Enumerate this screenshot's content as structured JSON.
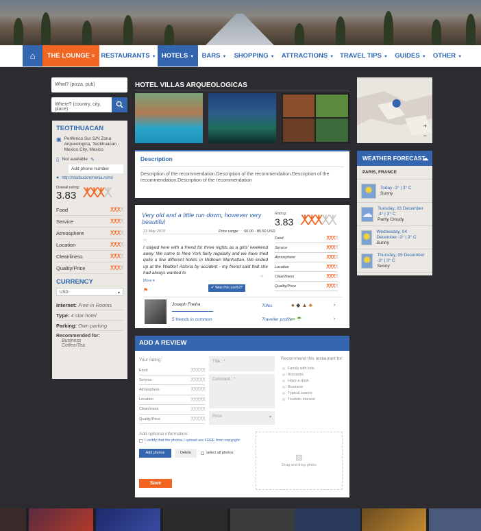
{
  "nav": {
    "lounge": "THE LOUNGE",
    "items": [
      "RESTAURANTS",
      "HOTELS",
      "BARS",
      "SHOPPING",
      "ATTRACTIONS",
      "TRAVEL TIPS",
      "GUIDES",
      "OTHER"
    ]
  },
  "search": {
    "what_placeholder": "What? (pizza, pub)",
    "where_placeholder": "Where? (country, city, place)"
  },
  "place": {
    "name": "TEOTIHUACAN",
    "address": "Periferico Sur S/N Zona Arqueologica, Teotihuacan - Mexico City, Mexico",
    "phone_status": "Not available",
    "phone_placeholder": "Add phone number",
    "website": "http://starbuckromania.ro/ro/",
    "overall_label": "Overall rating:",
    "overall_value": "3.83",
    "overall_fraction": 0.77,
    "ratings": [
      {
        "label": "Food",
        "value": 3
      },
      {
        "label": "Service",
        "value": 3
      },
      {
        "label": "Atmosphere",
        "value": 3
      },
      {
        "label": "Location",
        "value": 3
      },
      {
        "label": "Cleanliness",
        "value": 3
      },
      {
        "label": "Quality/Price",
        "value": 3
      }
    ],
    "currency_label": "CURRENCY",
    "currency_value": "USD",
    "internet_label": "Internet:",
    "internet_value": "Free in Rooms",
    "type_label": "Type:",
    "type_value": "4 star hotel",
    "parking_label": "Parking:",
    "parking_value": "Own parking",
    "recommended_label": "Recommended for:",
    "recommended": [
      "Business",
      "Coffee/Tea"
    ]
  },
  "hotel": {
    "title": "HOTEL VILLAS ARQUEOLOGICAS",
    "desc_title": "Description",
    "desc_text": "Description of the recommendation.Description of the recommendation.Description of the recommendation.Description of the recommendation"
  },
  "review": {
    "title": "Very old and a little run down, however very beautiful",
    "date": "23 May 2013",
    "price_label": "Price range:",
    "price_value": "60.00 - 85.50 USD",
    "text": "I stayed here with a friend for three nights as a girls' weekend away. We came to New York fairly regularly and we have tried quite a few different hotels in Midtown Manhattan. We ended up at the Waldorf Astoria by accident - my friend said that she had always wanted to",
    "more": "More",
    "useful": "Was this useful?",
    "rating_label": "Rating:",
    "rating_value": "3.83",
    "ratings": [
      "Food",
      "Service",
      "Atmosphere",
      "Location",
      "Cleanliness",
      "Quality/Price"
    ],
    "author": "Joseph Freiha",
    "friends": "5 friends in common",
    "titles_label": "Titles",
    "traveller_label": "Traveller profile"
  },
  "add_review": {
    "title": "ADD A REVIEW",
    "your_rating": "Your rating:",
    "ratings": [
      "Food",
      "Service",
      "Atmosphere",
      "Location",
      "Cleanliness",
      "Quality/Price"
    ],
    "title_placeholder": "Title : *",
    "comment_placeholder": "Comment : *",
    "price_placeholder": "Price",
    "recommend_label": "Recommend this restaurant for:",
    "recommend_options": [
      "Family with kids",
      "Romantic",
      "Have a drink",
      "Business",
      "Typical cuisine",
      "Touristic interest"
    ],
    "optional_label": "Add optional information:",
    "certify": "I certify that the photos I upload are FREE from copyright",
    "add_photos": "Add photos",
    "delete": "Delete",
    "select_all": "select all photos",
    "drop": "Drag and drop photo",
    "save": "Save"
  },
  "weather": {
    "title": "WEATHER FORECAST",
    "location": "PARIS, FRANCE",
    "days": [
      {
        "date": "Today",
        "temp": "-3° | 3° C",
        "desc": "Sunny",
        "icon": "sun-icon"
      },
      {
        "date": "Tuesday, 03 December",
        "temp": "-4° | 3° C",
        "desc": "Partly Cloudy",
        "icon": "cloud-sun-icon"
      },
      {
        "date": "Wednesday, 04 December",
        "temp": "-3° | 3° C",
        "desc": "Sunny",
        "icon": "sun-icon"
      },
      {
        "date": "Thursday, 05 December",
        "temp": "-3° | 3° C",
        "desc": "Sunny",
        "icon": "sun-icon"
      }
    ]
  },
  "colors": {
    "accent": "#3466b0",
    "orange": "#f26522",
    "bg": "#2b2b30"
  }
}
